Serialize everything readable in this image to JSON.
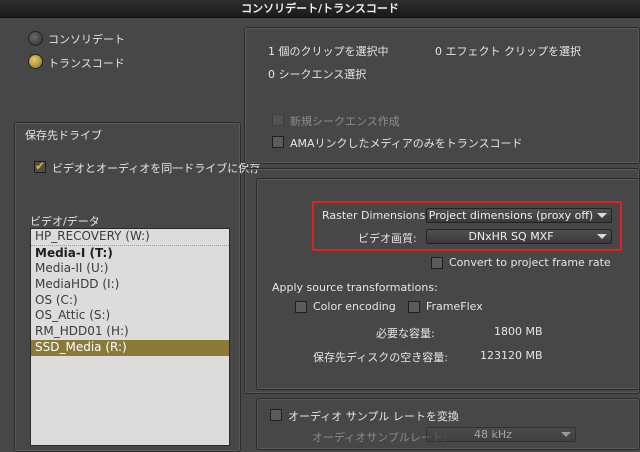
{
  "window": {
    "title": "コンソリデート/トランスコード"
  },
  "mode": {
    "consolidate_label": "コンソリデート",
    "transcode_label": "トランスコード",
    "selected": "transcode"
  },
  "drive": {
    "section_title": "保存先ドライブ",
    "same_drive_label": "ビデオとオーディオを同一ドライブに保存",
    "same_drive_checked": true,
    "video_data_label": "ビデオ/データ",
    "drives": [
      {
        "name": "HP_RECOVERY (W:)",
        "bold": false,
        "selected": false
      },
      {
        "name": "Media-I (T:)",
        "bold": true,
        "selected": false
      },
      {
        "name": "Media-II (U:)",
        "bold": false,
        "selected": false
      },
      {
        "name": "MediaHDD (I:)",
        "bold": false,
        "selected": false
      },
      {
        "name": "OS (C:)",
        "bold": false,
        "selected": false
      },
      {
        "name": "OS_Attic (S:)",
        "bold": false,
        "selected": false
      },
      {
        "name": "RM_HDD01 (H:)",
        "bold": false,
        "selected": false
      },
      {
        "name": "SSD_Media (R:)",
        "bold": false,
        "selected": true
      }
    ]
  },
  "selection": {
    "clips_selected": "1 個のクリップを選択中",
    "effect_clips": "0 エフェクト クリップを選択",
    "sequences_selected": "0 シークエンス選択",
    "new_sequence_label": "新規シークエンス作成",
    "ama_only_label": "AMAリンクしたメディアのみをトランスコード"
  },
  "transcode": {
    "raster_label": "Raster Dimensions:",
    "raster_value": "Project dimensions (proxy off)",
    "quality_label": "ビデオ画質:",
    "quality_value": "DNxHR SQ  MXF",
    "convert_frame_rate_label": "Convert to project frame rate",
    "apply_source_label": "Apply source transformations:",
    "color_encoding_label": "Color encoding",
    "frameflex_label": "FrameFlex",
    "required_space_label": "必要な容量:",
    "required_space_value": "1800 MB",
    "free_space_label": "保存先ディスクの空き容量:",
    "free_space_value": "123120 MB",
    "highlight_color": "#e0221f"
  },
  "audio": {
    "convert_label": "オーディオ サンプル レートを変換",
    "sample_rate_label": "オーディオサンプルレート:",
    "sample_rate_value": "48 kHz"
  }
}
